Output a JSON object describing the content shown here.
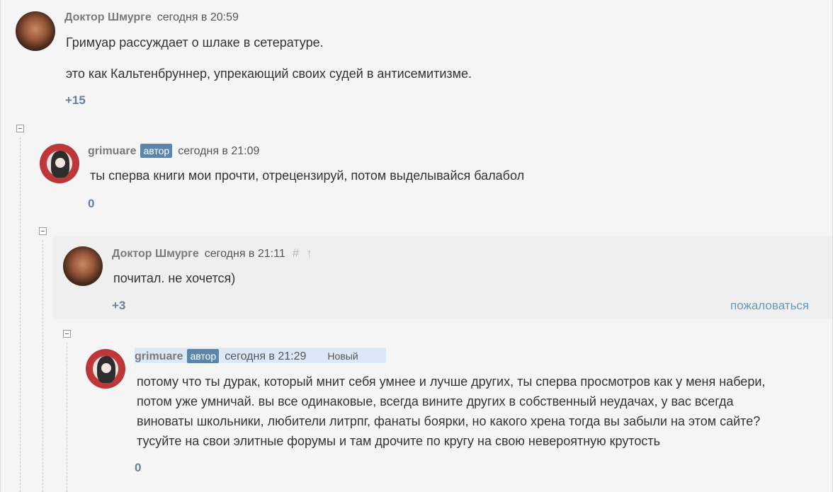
{
  "comments": [
    {
      "author": "Доктор Шмурге",
      "time": "сегодня в 20:59",
      "paragraphs": [
        "Гримуар рассуждает о шлаке в сетературе.",
        "это как Кальтенбруннер, упрекающий своих судей в антисемитизме."
      ],
      "score": "+15"
    },
    {
      "author": "grimuare",
      "badge": "автор",
      "time": "сегодня в 21:09",
      "text": "ты сперва книги мои прочти, отрецензируй, потом выделывайся балабол",
      "score": "0"
    },
    {
      "author": "Доктор Шмурге",
      "time": "сегодня в 21:11",
      "hash": "#",
      "up": "↑",
      "text": "почитал. не хочется)",
      "score": "+3",
      "report": "пожаловаться"
    },
    {
      "author": "grimuare",
      "badge": "автор",
      "time": "сегодня в 21:29",
      "new_label": "Новый",
      "lines": [
        "потому что ты дурак, который мнит себя умнее и лучше других, ты сперва просмотров как у меня набери,",
        "потом уже умничай. вы все одинаковые, всегда вините других в собственный неудачах, у вас всегда",
        "виноваты школьники, любители литрпг, фанаты боярки, но какого хрена тогда вы забыли на этом сайте?",
        "тусуйте на свои элитные форумы и там дрочите по кругу на свою невероятную крутость"
      ],
      "score": "0"
    }
  ]
}
